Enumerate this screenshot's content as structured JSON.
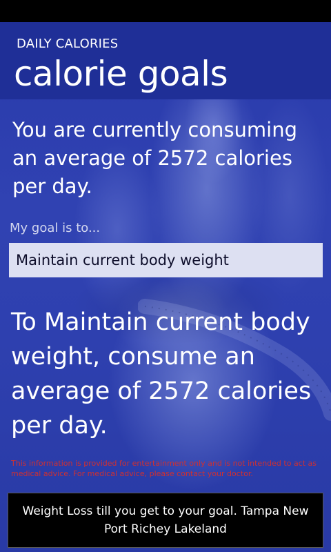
{
  "header": {
    "app_name": "DAILY CALORIES",
    "title": "calorie goals"
  },
  "main": {
    "current_message": "You are currently consuming an average of 2572 calories per day.",
    "goal_label": "My goal is to...",
    "goal_selected": "Maintain current body weight",
    "result_message": "To Maintain current body weight, consume an average of 2572 calories per day.",
    "disclaimer": "This information is provided for entertainment only and is not intended to act as medical advice.  For medical advice, please contact your doctor."
  },
  "ad": {
    "text": "Weight Loss till you get to your goal. Tampa New Port Richey Lakeland"
  },
  "colors": {
    "header_bg": "#1f2f97",
    "content_bg": "#2a3a9e",
    "select_bg": "#dde0f2",
    "disclaimer": "#d03030"
  }
}
